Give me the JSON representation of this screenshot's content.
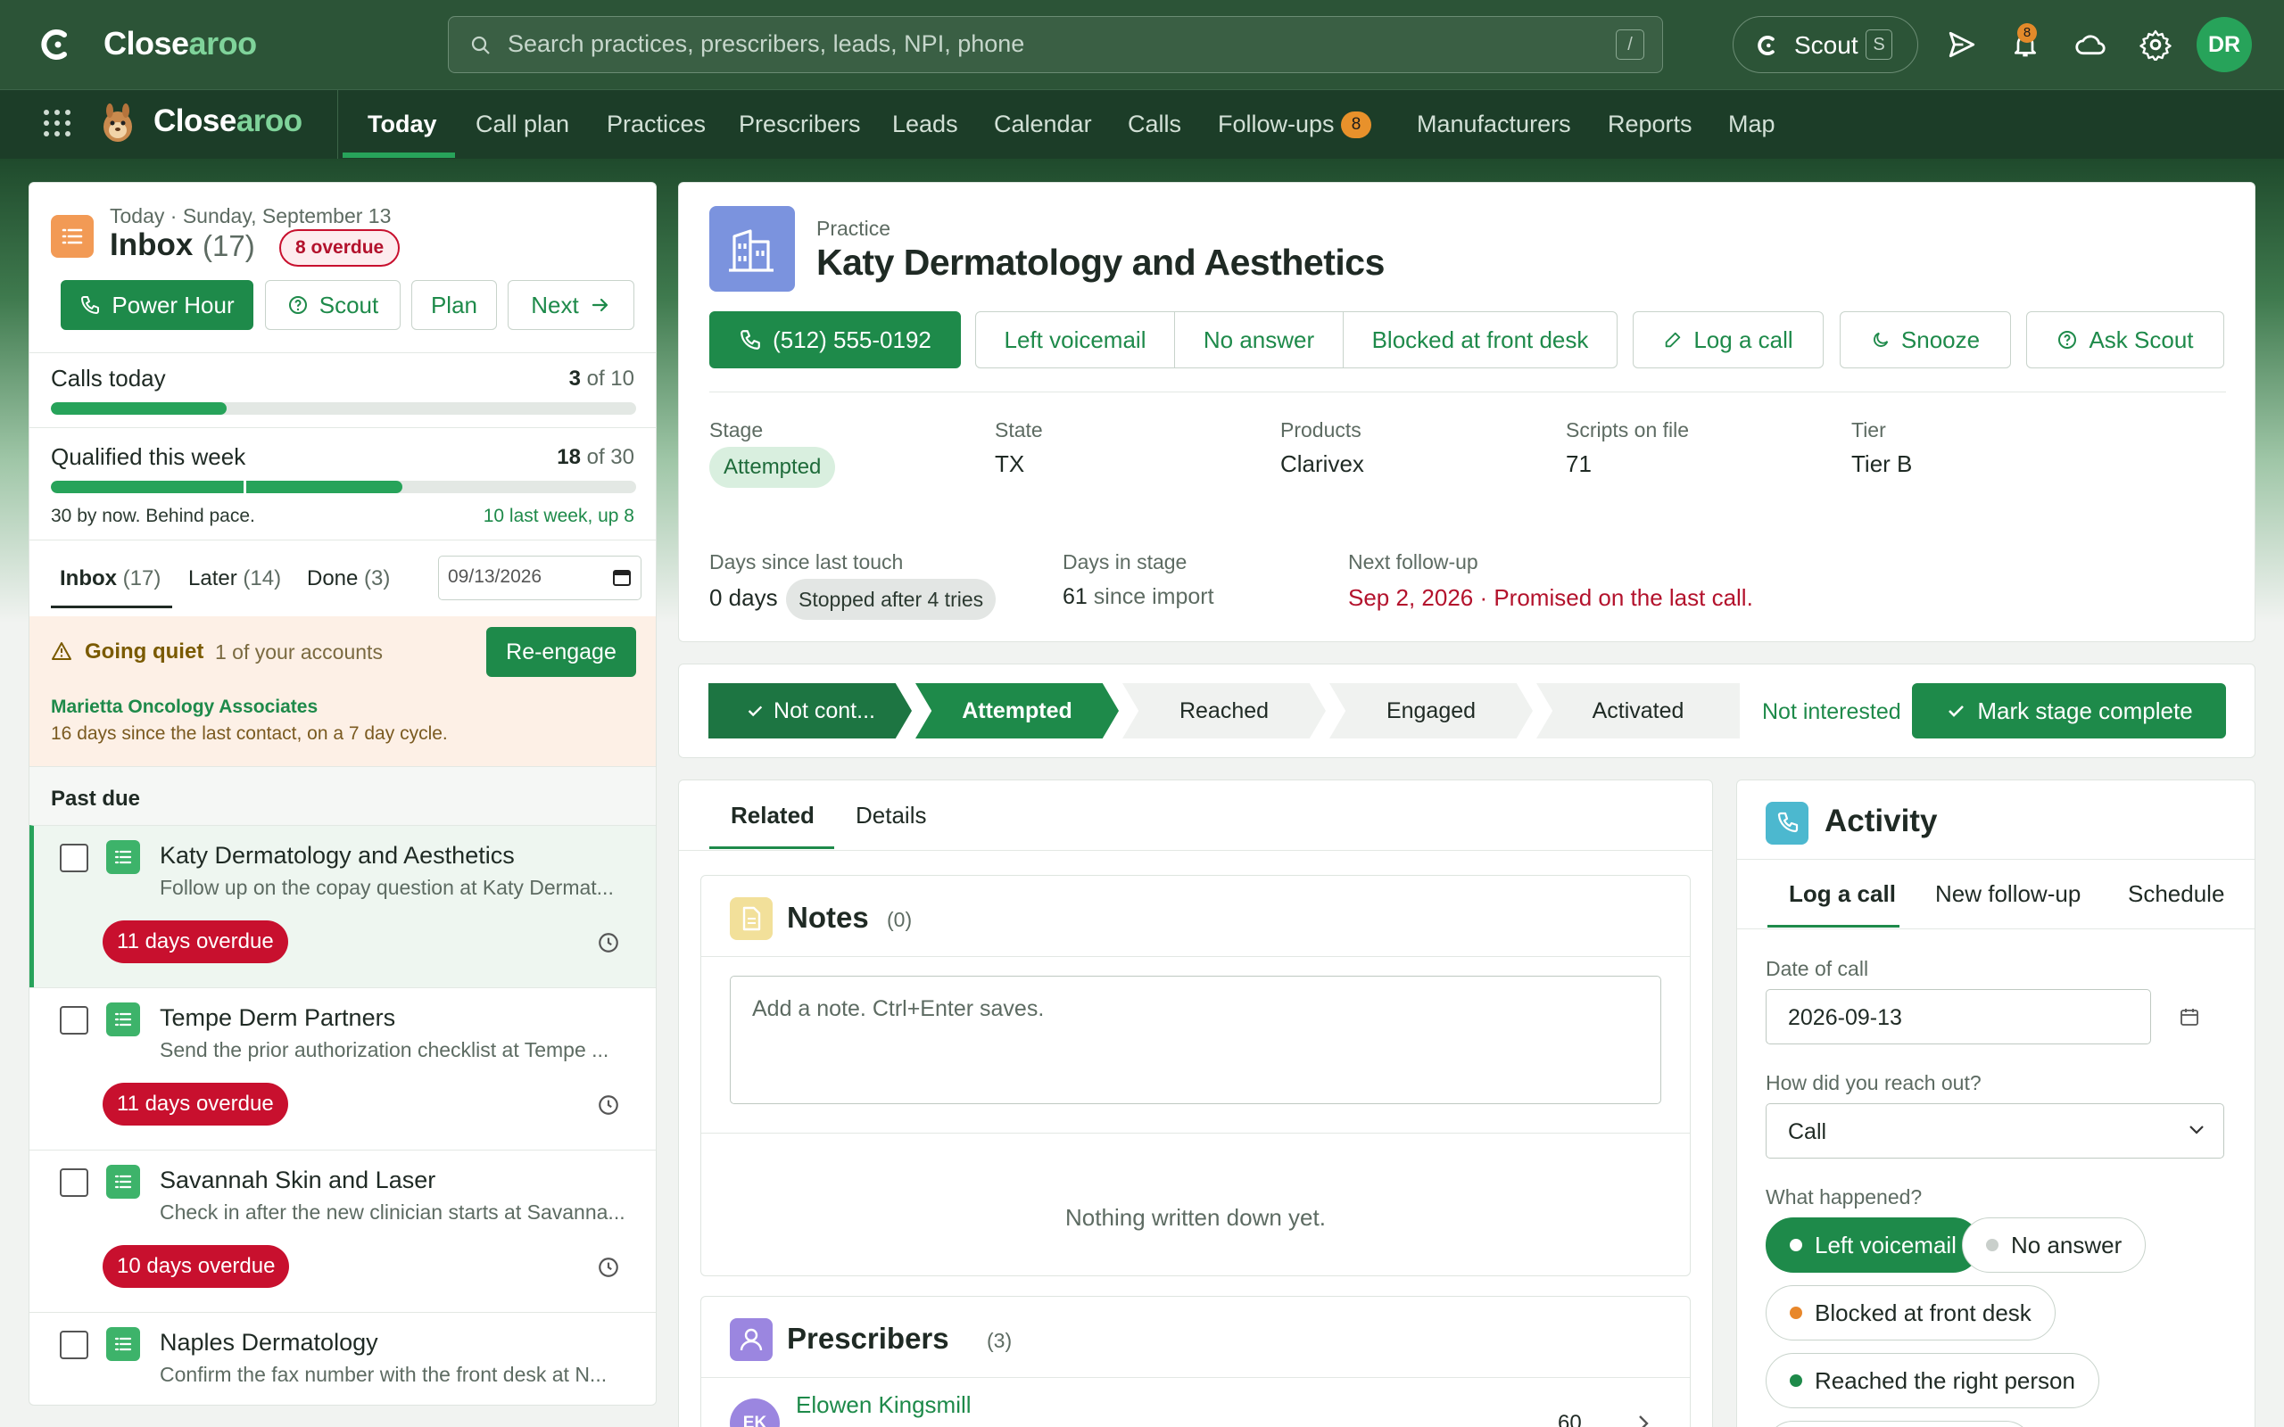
{
  "app": {
    "brand_part1": "Close",
    "brand_part2": "aroo"
  },
  "search": {
    "placeholder": "Search practices, prescribers, leads, NPI, phone",
    "shortcut": "/"
  },
  "scout_button": {
    "label": "Scout",
    "shortcut": "S"
  },
  "notifications": {
    "count": "8"
  },
  "user": {
    "initials": "DR"
  },
  "nav": {
    "brand_part1": "Close",
    "brand_part2": "aroo",
    "items": [
      "Today",
      "Call plan",
      "Practices",
      "Prescribers",
      "Leads",
      "Calendar",
      "Calls",
      "Follow-ups",
      "Manufacturers",
      "Reports",
      "Map"
    ],
    "followups_badge": "8"
  },
  "inbox": {
    "date_line": "Today · Sunday, September 13",
    "title": "Inbox",
    "count": "(17)",
    "overdue_badge": "8 overdue",
    "buttons": {
      "power_hour": "Power Hour",
      "scout": "Scout",
      "plan": "Plan",
      "next": "Next"
    },
    "calls_today": {
      "label": "Calls today",
      "value": "3",
      "of": "of 10",
      "progress": 0.3
    },
    "qualified": {
      "label": "Qualified this week",
      "value": "18",
      "of": "of 30",
      "progress": 0.6,
      "pace_marker": 0.33,
      "note_left": "30 by now. Behind pace.",
      "note_right": "10 last week, up 8"
    },
    "tabs": [
      {
        "label": "Inbox",
        "count": "(17)"
      },
      {
        "label": "Later",
        "count": "(14)"
      },
      {
        "label": "Done",
        "count": "(3)"
      }
    ],
    "date_filter": "09/13/2026",
    "going_quiet": {
      "title": "Going quiet",
      "subtitle": "1 of your accounts",
      "button": "Re-engage",
      "account": "Marietta Oncology Associates",
      "detail": "16 days since the last contact, on a 7 day cycle."
    },
    "section_title": "Past due",
    "tasks": [
      {
        "name": "Katy Dermatology and Aesthetics",
        "desc": "Follow up on the copay question at Katy Dermat...",
        "badge": "11 days overdue"
      },
      {
        "name": "Tempe Derm Partners",
        "desc": "Send the prior authorization checklist at Tempe ...",
        "badge": "11 days overdue"
      },
      {
        "name": "Savannah Skin and Laser",
        "desc": "Check in after the new clinician starts at Savanna...",
        "badge": "10 days overdue"
      },
      {
        "name": "Naples Dermatology",
        "desc": "Confirm the fax number with the front desk at N...",
        "badge": ""
      }
    ]
  },
  "practice": {
    "kind": "Practice",
    "name": "Katy Dermatology and Aesthetics",
    "phone": "(512) 555-0192",
    "quick_outcomes": [
      "Left voicemail",
      "No answer",
      "Blocked at front desk"
    ],
    "actions": {
      "log_call": "Log a call",
      "snooze": "Snooze",
      "ask_scout": "Ask Scout"
    },
    "fields": [
      {
        "label": "Stage",
        "value": "Attempted"
      },
      {
        "label": "State",
        "value": "TX"
      },
      {
        "label": "Products",
        "value": "Clarivex"
      },
      {
        "label": "Scripts on file",
        "value": "71"
      },
      {
        "label": "Tier",
        "value": "Tier B"
      }
    ],
    "last_touch": {
      "label": "Days since last touch",
      "value": "0 days",
      "badge": "Stopped after 4 tries"
    },
    "days_in_stage": {
      "label": "Days in stage",
      "value": "61",
      "suffix": "since import"
    },
    "next_followup": {
      "label": "Next follow-up",
      "value": "Sep 2, 2026 · Promised on the last call."
    }
  },
  "stages": {
    "items": [
      "Not cont...",
      "Attempted",
      "Reached",
      "Engaged",
      "Activated"
    ],
    "not_interested": "Not interested",
    "complete_button": "Mark stage complete"
  },
  "related": {
    "tabs": [
      "Related",
      "Details"
    ],
    "notes": {
      "title": "Notes",
      "count": "(0)",
      "placeholder": "Add a note. Ctrl+Enter saves.",
      "empty": "Nothing written down yet."
    },
    "prescribers": {
      "title": "Prescribers",
      "count": "(3)",
      "first_initials": "EK",
      "first_name": "Elowen Kingsmill",
      "first_value": "60"
    }
  },
  "activity": {
    "title": "Activity",
    "tabs": [
      "Log a call",
      "New follow-up",
      "Schedule"
    ],
    "date_label": "Date of call",
    "date_value": "2026-09-13",
    "reach_label": "How did you reach out?",
    "reach_value": "Call",
    "happened_label": "What happened?",
    "outcomes": [
      {
        "label": "Left voicemail",
        "dot": "#ffffff"
      },
      {
        "label": "No answer",
        "dot": "#c9cfcb"
      },
      {
        "label": "Blocked at front desk",
        "dot": "#e8872b"
      },
      {
        "label": "Reached the right person",
        "dot": "#1e8a4a"
      }
    ]
  },
  "colors": {
    "brand_green": "#1e8a4a",
    "header": "#2c5437",
    "overdue_red": "#c8102e",
    "warning_orange": "#e8872b"
  }
}
